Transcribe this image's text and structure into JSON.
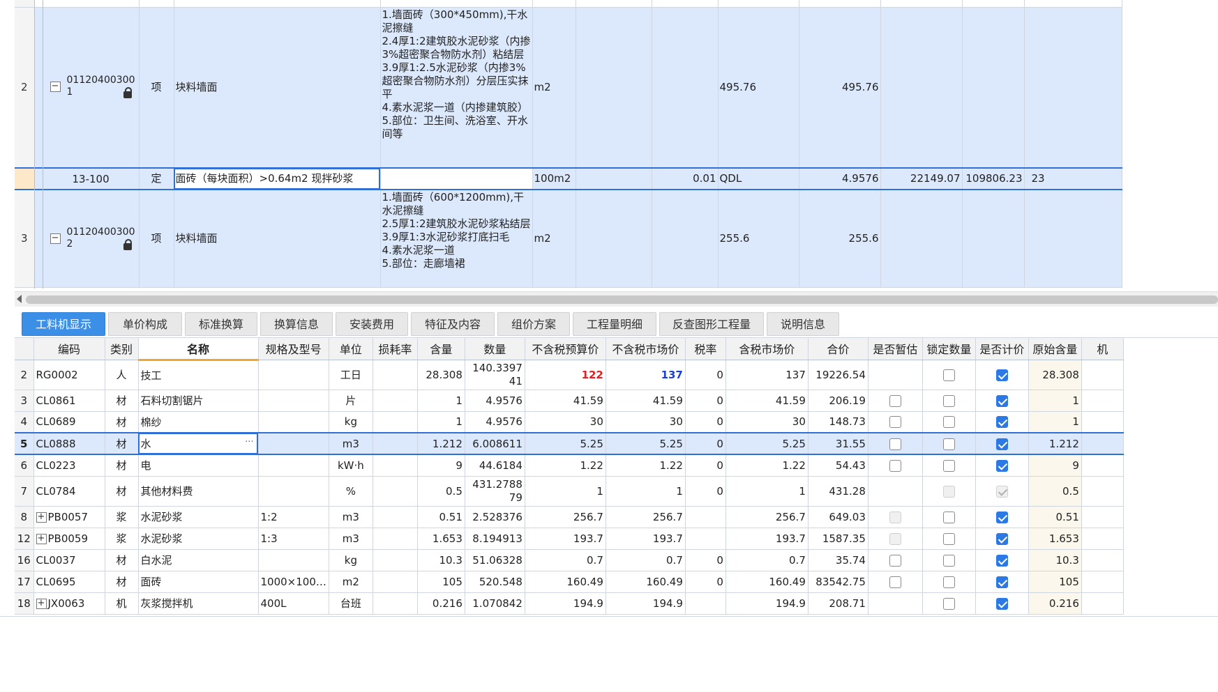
{
  "upper_grid": {
    "top_partial_row": {
      "cells": [
        "",
        "",
        ""
      ]
    },
    "rows": [
      {
        "row_no": "2",
        "code_line1": "01120400300",
        "code_line2": "1",
        "type": "项",
        "name": "块料墙面",
        "features": "1.墙面砖（300*450mm),干水泥擦缝\n2.4厚1:2建筑胶水泥砂浆（内掺3%超密聚合物防水剂）粘结层\n3.9厚1:2.5水泥砂浆（内掺3%超密聚合物防水剂）分层压实抹平\n4.素水泥浆一道（内掺建筑胶）\n5.部位：卫生间、洗浴室、开水间等",
        "unit": "m2",
        "qty_expr": "495.76",
        "qty": "495.76"
      },
      {
        "row_no": "",
        "code": "13-100",
        "type": "定",
        "name": "面砖（每块面积）>0.64m2 现拌砂浆",
        "unit": "100m2",
        "coef": "0.01",
        "qty_expr": "QDL",
        "qty": "4.9576",
        "unit_price": "22149.07",
        "total": "109806.23",
        "extra": "23"
      },
      {
        "row_no": "3",
        "code_line1": "01120400300",
        "code_line2": "2",
        "type": "项",
        "name": "块料墙面",
        "features": "1.墙面砖（600*1200mm),干水泥擦缝\n2.5厚1:2建筑胶水泥砂浆粘结层\n3.9厚1:3水泥砂浆打底扫毛\n4.素水泥浆一道\n5.部位：走廊墙裙",
        "unit": "m2",
        "qty_expr": "255.6",
        "qty": "255.6"
      }
    ]
  },
  "tabs": [
    {
      "label": "工料机显示",
      "active": true
    },
    {
      "label": "单价构成"
    },
    {
      "label": "标准换算"
    },
    {
      "label": "换算信息"
    },
    {
      "label": "安装费用"
    },
    {
      "label": "特征及内容"
    },
    {
      "label": "组价方案"
    },
    {
      "label": "工程量明细"
    },
    {
      "label": "反查图形工程量"
    },
    {
      "label": "说明信息"
    }
  ],
  "lower_grid": {
    "columns": [
      "编码",
      "类别",
      "名称",
      "规格及型号",
      "单位",
      "损耗率",
      "含量",
      "数量",
      "不含税预算价",
      "不含税市场价",
      "税率",
      "含税市场价",
      "合价",
      "是否暂估",
      "锁定数量",
      "是否计价",
      "原始含量",
      "机"
    ],
    "rows": [
      {
        "no": "2",
        "code": "RG0002",
        "cat": "人",
        "name": "技工",
        "spec": "",
        "unit": "工日",
        "loss": "",
        "content": "28.308",
        "qty": "140.339741",
        "budget": "122",
        "market": "137",
        "tax": "0",
        "tax_market": "137",
        "total": "19226.54",
        "est": "none",
        "lock": "off",
        "priced": "on",
        "orig": "28.308",
        "budget_style": "red",
        "market_style": "blu",
        "tall": true
      },
      {
        "no": "3",
        "code": "CL0861",
        "cat": "材",
        "name": "石料切割锯片",
        "spec": "",
        "unit": "片",
        "loss": "",
        "content": "1",
        "qty": "4.9576",
        "budget": "41.59",
        "market": "41.59",
        "tax": "0",
        "tax_market": "41.59",
        "total": "206.19",
        "est": "off",
        "lock": "off",
        "priced": "on",
        "orig": "1"
      },
      {
        "no": "4",
        "code": "CL0689",
        "cat": "材",
        "name": "棉纱",
        "spec": "",
        "unit": "kg",
        "loss": "",
        "content": "1",
        "qty": "4.9576",
        "budget": "30",
        "market": "30",
        "tax": "0",
        "tax_market": "30",
        "total": "148.73",
        "est": "off",
        "lock": "off",
        "priced": "on",
        "orig": "1"
      },
      {
        "no": "5",
        "code": "CL0888",
        "cat": "材",
        "name": "水",
        "spec": "",
        "unit": "m3",
        "loss": "",
        "content": "1.212",
        "qty": "6.008611",
        "budget": "5.25",
        "market": "5.25",
        "tax": "0",
        "tax_market": "5.25",
        "total": "31.55",
        "est": "off",
        "lock": "off",
        "priced": "on",
        "orig": "1.212",
        "selected": true
      },
      {
        "no": "6",
        "code": "CL0223",
        "cat": "材",
        "name": "电",
        "spec": "",
        "unit": "kW·h",
        "loss": "",
        "content": "9",
        "qty": "44.6184",
        "budget": "1.22",
        "market": "1.22",
        "tax": "0",
        "tax_market": "1.22",
        "total": "54.43",
        "est": "off",
        "lock": "off",
        "priced": "on",
        "orig": "9"
      },
      {
        "no": "7",
        "code": "CL0784",
        "cat": "材",
        "name": "其他材料费",
        "spec": "",
        "unit": "%",
        "loss": "",
        "content": "0.5",
        "qty": "431.278879",
        "budget": "1",
        "market": "1",
        "tax": "0",
        "tax_market": "1",
        "total": "431.28",
        "est": "none",
        "lock": "dis",
        "priced": "dison",
        "orig": "0.5",
        "tall": true
      },
      {
        "no": "8",
        "code": "PB0057",
        "cat": "浆",
        "name": "水泥砂浆",
        "spec": "1:2",
        "unit": "m3",
        "loss": "",
        "content": "0.51",
        "qty": "2.528376",
        "budget": "256.7",
        "market": "256.7",
        "tax": "",
        "tax_market": "256.7",
        "total": "649.03",
        "est": "dis",
        "lock": "off",
        "priced": "on",
        "orig": "0.51",
        "expand": true
      },
      {
        "no": "12",
        "code": "PB0059",
        "cat": "浆",
        "name": "水泥砂浆",
        "spec": "1:3",
        "unit": "m3",
        "loss": "",
        "content": "1.653",
        "qty": "8.194913",
        "budget": "193.7",
        "market": "193.7",
        "tax": "",
        "tax_market": "193.7",
        "total": "1587.35",
        "est": "dis",
        "lock": "off",
        "priced": "on",
        "orig": "1.653",
        "expand": true
      },
      {
        "no": "16",
        "code": "CL0037",
        "cat": "材",
        "name": "白水泥",
        "spec": "",
        "unit": "kg",
        "loss": "",
        "content": "10.3",
        "qty": "51.06328",
        "budget": "0.7",
        "market": "0.7",
        "tax": "0",
        "tax_market": "0.7",
        "total": "35.74",
        "est": "off",
        "lock": "off",
        "priced": "on",
        "orig": "10.3"
      },
      {
        "no": "17",
        "code": "CL0695",
        "cat": "材",
        "name": "面砖",
        "spec": "1000×100…",
        "unit": "m2",
        "loss": "",
        "content": "105",
        "qty": "520.548",
        "budget": "160.49",
        "market": "160.49",
        "tax": "0",
        "tax_market": "160.49",
        "total": "83542.75",
        "est": "off",
        "lock": "off",
        "priced": "on",
        "orig": "105"
      },
      {
        "no": "18",
        "code": "JX0063",
        "cat": "机",
        "name": "灰浆搅拌机",
        "spec": "400L",
        "unit": "台班",
        "loss": "",
        "content": "0.216",
        "qty": "1.070842",
        "budget": "194.9",
        "market": "194.9",
        "tax": "",
        "tax_market": "194.9",
        "total": "208.71",
        "est": "none",
        "lock": "off",
        "priced": "on",
        "orig": "0.216",
        "expand": true
      }
    ]
  },
  "selected_name_ellipsis": "···",
  "colors": {
    "tab_active": "#3b8fe7",
    "row_selected": "#dce8fb",
    "checkbox_on": "#2c78e4"
  }
}
